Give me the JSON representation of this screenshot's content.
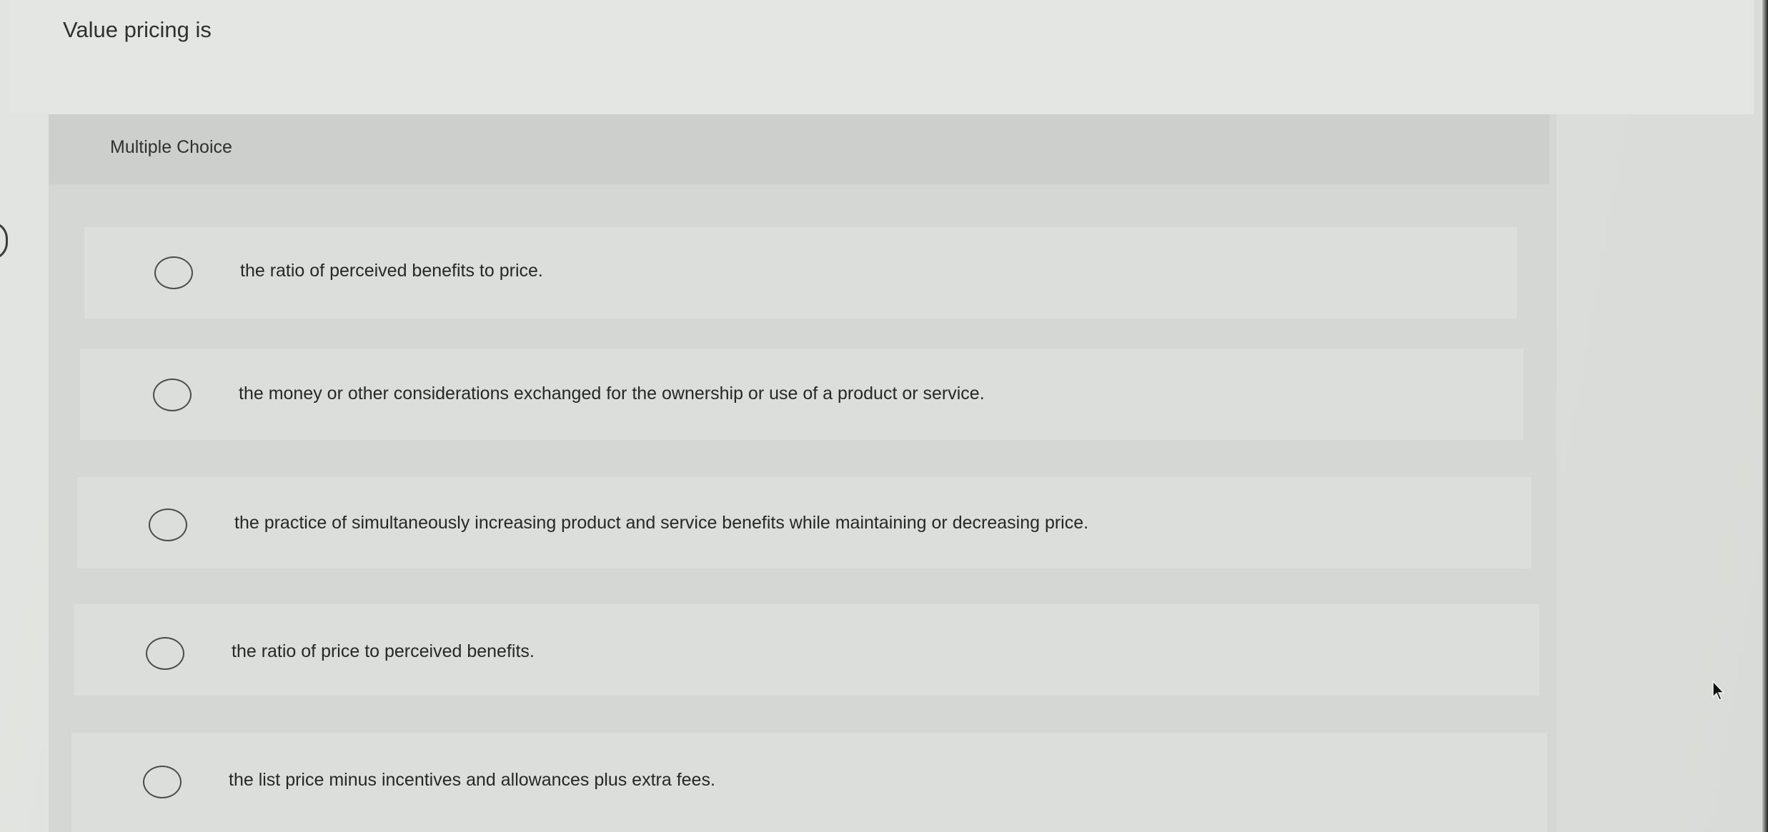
{
  "question": {
    "prompt": "Value pricing is"
  },
  "choices": {
    "label": "Multiple Choice",
    "options": [
      {
        "text": "the ratio of perceived benefits to price."
      },
      {
        "text": "the money or other considerations exchanged for the ownership or use of a product or service."
      },
      {
        "text": "the practice of simultaneously increasing product and service benefits while maintaining or decreasing price."
      },
      {
        "text": "the ratio of price to perceived benefits."
      },
      {
        "text": "the list price minus incentives and allowances plus extra fees."
      }
    ]
  }
}
